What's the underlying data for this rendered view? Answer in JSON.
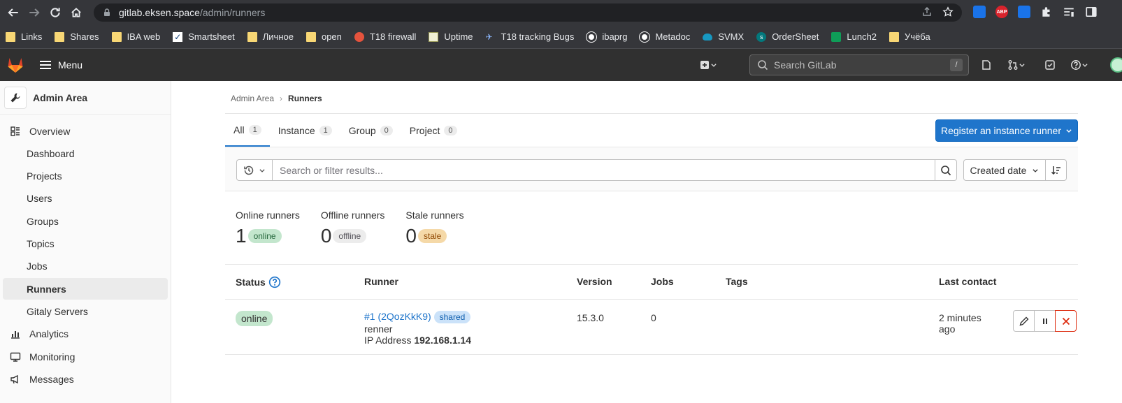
{
  "browser": {
    "url_host": "gitlab.eksen.space",
    "url_path": "/admin/runners",
    "extensions": [
      {
        "name": "blue-square-extension-icon",
        "color": "#1a73e8",
        "text": ""
      },
      {
        "name": "adblock-icon",
        "color": "#d9232c",
        "text": "ABP"
      },
      {
        "name": "shield-extension-icon",
        "color": "#1a73e8",
        "text": ""
      }
    ]
  },
  "bookmarks": [
    {
      "label": "Links",
      "icon": "folder-icon"
    },
    {
      "label": "Shares",
      "icon": "folder-icon"
    },
    {
      "label": "IBA web",
      "icon": "folder-icon"
    },
    {
      "label": "Smartsheet",
      "icon": "smartsheet-icon"
    },
    {
      "label": "Личное",
      "icon": "folder-icon"
    },
    {
      "label": "open",
      "icon": "folder-icon"
    },
    {
      "label": "T18 firewall",
      "icon": "firewall-icon"
    },
    {
      "label": "Uptime",
      "icon": "uptime-icon"
    },
    {
      "label": "T18 tracking Bugs",
      "icon": "bug-icon"
    },
    {
      "label": "ibaprg",
      "icon": "globe-icon"
    },
    {
      "label": "Metadoc",
      "icon": "globe-icon"
    },
    {
      "label": "SVMX",
      "icon": "cloud-icon"
    },
    {
      "label": "OrderSheet",
      "icon": "sharepoint-icon"
    },
    {
      "label": "Lunch2",
      "icon": "sheets-icon"
    },
    {
      "label": "Учёба",
      "icon": "folder-icon"
    }
  ],
  "header": {
    "menu_label": "Menu",
    "search_placeholder": "Search GitLab",
    "search_shortcut": "/"
  },
  "sidebar": {
    "title": "Admin Area",
    "items": [
      {
        "label": "Overview",
        "type": "top",
        "icon": "overview-icon"
      },
      {
        "label": "Dashboard",
        "type": "sub"
      },
      {
        "label": "Projects",
        "type": "sub"
      },
      {
        "label": "Users",
        "type": "sub"
      },
      {
        "label": "Groups",
        "type": "sub"
      },
      {
        "label": "Topics",
        "type": "sub"
      },
      {
        "label": "Jobs",
        "type": "sub"
      },
      {
        "label": "Runners",
        "type": "sub",
        "active": true
      },
      {
        "label": "Gitaly Servers",
        "type": "sub"
      },
      {
        "label": "Analytics",
        "type": "top",
        "icon": "analytics-icon"
      },
      {
        "label": "Monitoring",
        "type": "top",
        "icon": "monitor-icon"
      },
      {
        "label": "Messages",
        "type": "top",
        "icon": "megaphone-icon"
      }
    ]
  },
  "breadcrumb": {
    "parent": "Admin Area",
    "current": "Runners"
  },
  "tabs": [
    {
      "label": "All",
      "count": "1",
      "active": true
    },
    {
      "label": "Instance",
      "count": "1"
    },
    {
      "label": "Group",
      "count": "0"
    },
    {
      "label": "Project",
      "count": "0"
    }
  ],
  "register_button": "Register an instance runner",
  "filter": {
    "placeholder": "Search or filter results...",
    "sort_label": "Created date"
  },
  "stats": [
    {
      "label": "Online runners",
      "value": "1",
      "badge": "online",
      "kind": "online"
    },
    {
      "label": "Offline runners",
      "value": "0",
      "badge": "offline",
      "kind": "offline"
    },
    {
      "label": "Stale runners",
      "value": "0",
      "badge": "stale",
      "kind": "stale"
    }
  ],
  "table": {
    "headers": {
      "status": "Status",
      "runner": "Runner",
      "version": "Version",
      "jobs": "Jobs",
      "tags": "Tags",
      "last_contact": "Last contact"
    },
    "rows": [
      {
        "status": "online",
        "runner_id": "#1 (2QozKkK9)",
        "runner_type": "shared",
        "description": "renner",
        "ip_label": "IP Address",
        "ip": "192.168.1.14",
        "version": "15.3.0",
        "jobs": "0",
        "tags": "",
        "last_contact_line1": "2 minutes",
        "last_contact_line2": "ago"
      }
    ]
  },
  "colors": {
    "primary": "#1f75cb",
    "header_bg": "#303030",
    "danger": "#dd2b0e"
  }
}
